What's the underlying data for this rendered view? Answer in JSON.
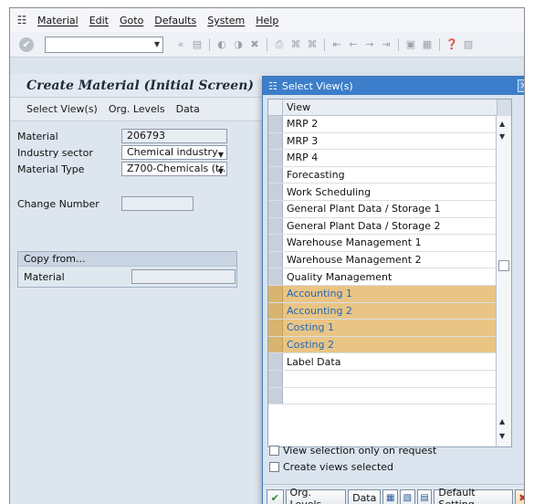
{
  "menubar": {
    "items": [
      "Material",
      "Edit",
      "Goto",
      "Defaults",
      "System",
      "Help"
    ]
  },
  "toolbar": {
    "command_value": "",
    "icons": [
      "enter-icon",
      "save-icon",
      "back-icon",
      "exit-icon",
      "cancel-icon",
      "print-icon",
      "find-icon",
      "find-next-icon",
      "first-page-icon",
      "previous-page-icon",
      "next-page-icon",
      "last-page-icon",
      "new-session-icon",
      "shortcut-icon",
      "help-icon",
      "customize-icon"
    ]
  },
  "screen": {
    "title": "Create Material (Initial Screen)"
  },
  "appbar": {
    "select_views": "Select View(s)",
    "org_levels": "Org. Levels",
    "data": "Data"
  },
  "form": {
    "material_label": "Material",
    "material_value": "206793",
    "industry_label": "Industry sector",
    "industry_value": "Chemical industry",
    "type_label": "Material Type",
    "type_value": "Z700-Chemicals (tr...",
    "change_label": "Change Number",
    "change_value": "",
    "copy_title": "Copy from...",
    "copy_material_label": "Material",
    "copy_material_value": ""
  },
  "dialog": {
    "title": "Select View(s)",
    "column": "View",
    "views": [
      {
        "label": "MRP 2",
        "selected": false
      },
      {
        "label": "MRP 3",
        "selected": false
      },
      {
        "label": "MRP 4",
        "selected": false
      },
      {
        "label": "Forecasting",
        "selected": false
      },
      {
        "label": "Work Scheduling",
        "selected": false
      },
      {
        "label": "General Plant Data / Storage 1",
        "selected": false
      },
      {
        "label": "General Plant Data / Storage 2",
        "selected": false
      },
      {
        "label": "Warehouse Management 1",
        "selected": false
      },
      {
        "label": "Warehouse Management 2",
        "selected": false
      },
      {
        "label": "Quality Management",
        "selected": false
      },
      {
        "label": "Accounting 1",
        "selected": true
      },
      {
        "label": "Accounting 2",
        "selected": true
      },
      {
        "label": "Costing 1",
        "selected": true
      },
      {
        "label": "Costing 2",
        "selected": true
      },
      {
        "label": "Label Data",
        "selected": false
      },
      {
        "label": "",
        "selected": false
      },
      {
        "label": "",
        "selected": false
      }
    ],
    "option_request": "View selection only on request",
    "option_create": "Create views selected",
    "footer": {
      "org_levels": "Org. Levels",
      "data": "Data",
      "default_setting": "Default Setting"
    }
  },
  "colors": {
    "selected_row": "#e9c585",
    "title_blue": "#3c7ec9"
  }
}
